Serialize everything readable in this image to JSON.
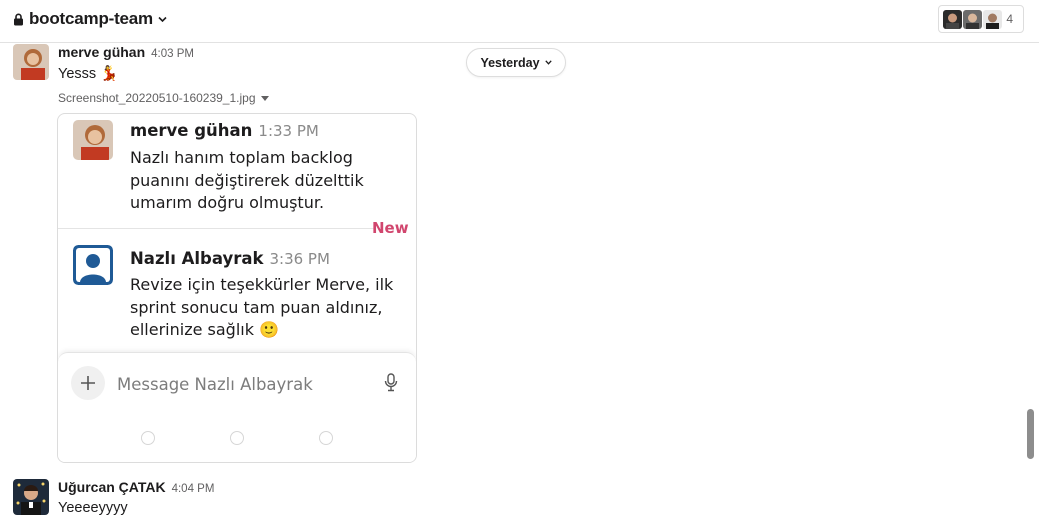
{
  "channel": {
    "name": "bootcamp-team",
    "member_count": "4"
  },
  "divider": {
    "label": "Yesterday"
  },
  "messages": [
    {
      "author": "merve gühan",
      "time": "4:03 PM",
      "text": "Yesss 💃"
    },
    {
      "author": "Uğurcan ÇATAK",
      "time": "4:04 PM",
      "text": "Yeeeeyyyy"
    }
  ],
  "attachment": {
    "file_name": "Screenshot_20220510-160239_1.jpg",
    "messages": [
      {
        "author": "merve gühan",
        "time": "1:33 PM",
        "text": "Nazlı hanım toplam backlog puanını değiştirerek düzelttik umarım doğru olmuştur."
      },
      {
        "author": "Nazlı Albayrak",
        "time": "3:36 PM",
        "text": "Revize için teşekkürler Merve, ilk sprint sonucu tam puan aldınız, ellerinize sağlık 🙂"
      }
    ],
    "new_label": "New",
    "composer_placeholder": "Message Nazlı Albayrak"
  },
  "icons": {
    "lock": "lock-icon",
    "chevron": "chevron-down-icon",
    "plus": "plus-icon",
    "mic": "microphone-icon",
    "default_avatar": "default-avatar-icon"
  },
  "colors": {
    "new_badge": "#d1466e",
    "default_avatar_bg": "#1f5a96"
  }
}
